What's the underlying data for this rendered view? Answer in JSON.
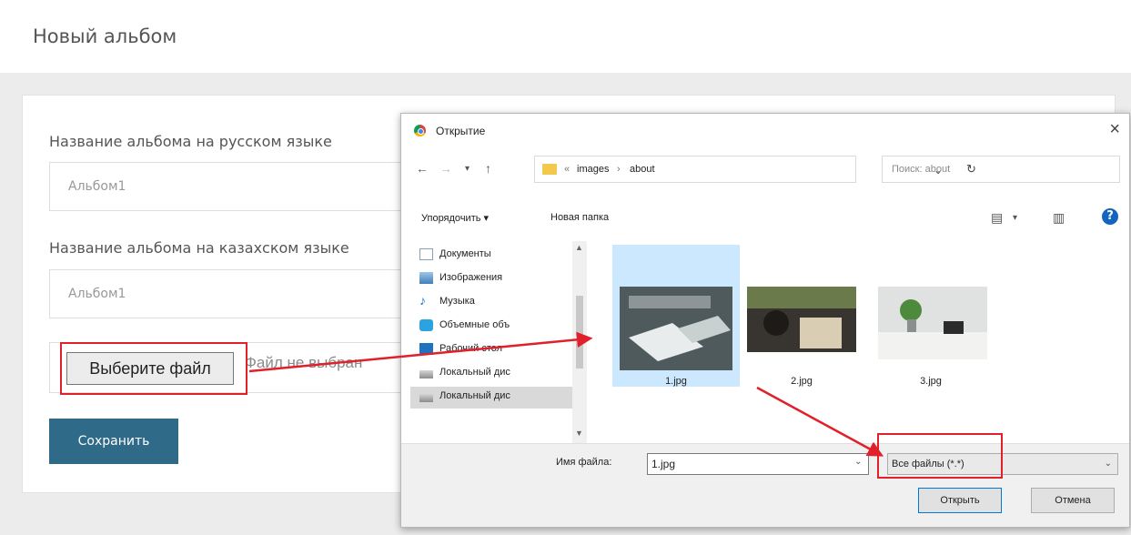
{
  "page": {
    "title": "Новый альбом",
    "form": {
      "ru_label": "Название альбома на русском языке",
      "ru_value": "Альбом1",
      "kz_label": "Название альбома на казахском языке",
      "kz_value": "Альбом1",
      "file_button": "Выберите файл",
      "file_status": "Файл не выбран",
      "save_button": "Сохранить"
    }
  },
  "dialog": {
    "title": "Открытие",
    "breadcrumbs": [
      "«",
      "images",
      "›",
      "about"
    ],
    "search_placeholder": "Поиск: about",
    "toolbar": {
      "organize": "Упорядочить ▾",
      "new_folder": "Новая папка"
    },
    "sidebar": [
      {
        "label": "Документы",
        "icon": "documents-icon"
      },
      {
        "label": "Изображения",
        "icon": "pictures-icon"
      },
      {
        "label": "Музыка",
        "icon": "music-icon"
      },
      {
        "label": "Объемные объ",
        "icon": "3d-objects-icon"
      },
      {
        "label": "Рабочий стол",
        "icon": "desktop-icon"
      },
      {
        "label": "Локальный дис",
        "icon": "drive-icon"
      },
      {
        "label": "Локальный дис",
        "icon": "drive-icon"
      }
    ],
    "files": [
      {
        "name": "1.jpg",
        "selected": true
      },
      {
        "name": "2.jpg",
        "selected": false
      },
      {
        "name": "3.jpg",
        "selected": false
      }
    ],
    "filename_label": "Имя файла:",
    "filename_value": "1.jpg",
    "filter_value": "Все файлы (*.*)",
    "open_button": "Открыть",
    "cancel_button": "Отмена"
  },
  "colors": {
    "save_button": "#2f6b89",
    "highlight": "#e0202b",
    "selection": "#cce8ff"
  }
}
